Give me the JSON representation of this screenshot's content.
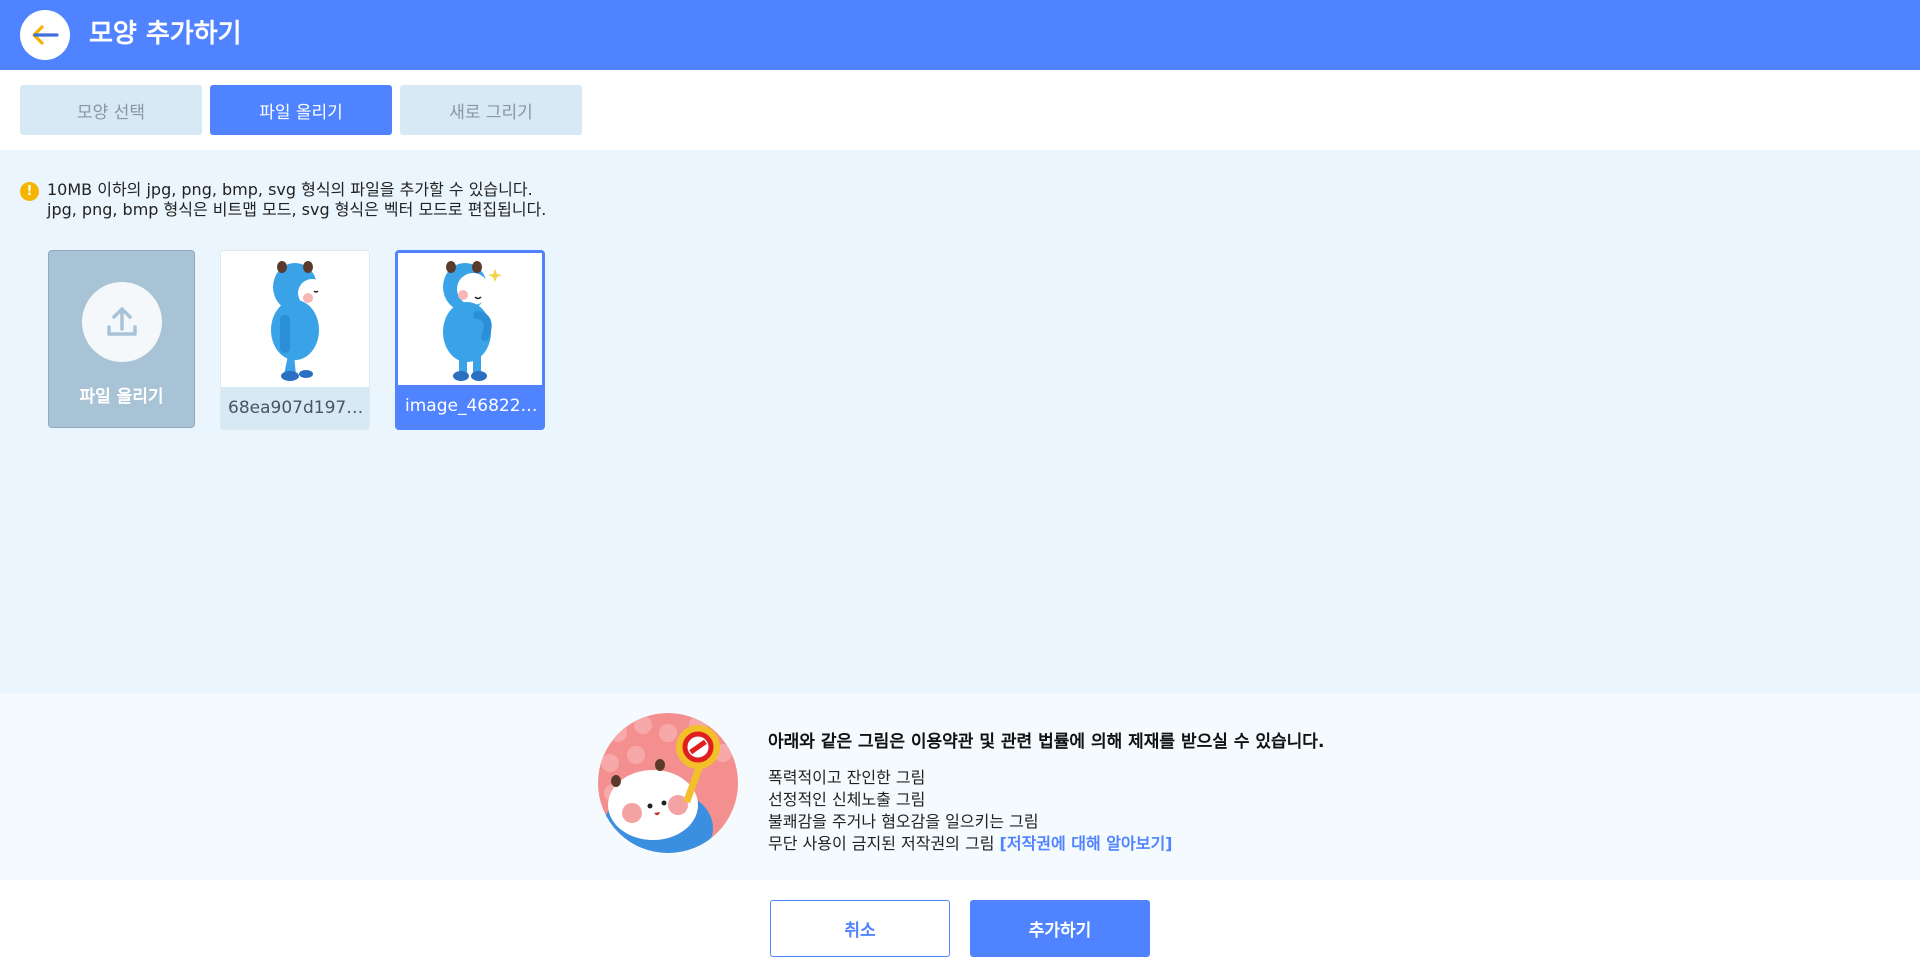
{
  "header": {
    "title": "모양 추가하기",
    "back_icon": "arrow-left-icon"
  },
  "tabs": [
    {
      "label": "모양 선택",
      "active": false
    },
    {
      "label": "파일 올리기",
      "active": true
    },
    {
      "label": "새로 그리기",
      "active": false
    }
  ],
  "notice": {
    "icon": "exclamation-icon",
    "line1": "10MB 이하의 jpg, png, bmp, svg 형식의 파일을 추가할 수 있습니다.",
    "line2": "jpg, png, bmp 형식은 비트맵 모드, svg 형식은 벡터 모드로 편집됩니다."
  },
  "upload": {
    "label": "파일 올리기",
    "icon": "upload-icon"
  },
  "files": [
    {
      "name": "68ea907d197…",
      "selected": false
    },
    {
      "name": "image_468221…",
      "selected": true
    }
  ],
  "warning": {
    "title": "아래와 같은 그림은 이용약관 및 관련 법률에 의해 제재를 받으실 수 있습니다.",
    "items": [
      "폭력적이고 잔인한 그림",
      "선정적인 신체노출 그림",
      "불쾌감을 주거나 혐오감을 일으키는 그림",
      "무단 사용이 금지된 저작권의 그림"
    ],
    "link": "[저작권에 대해 알아보기]"
  },
  "buttons": {
    "cancel": "취소",
    "confirm": "추가하기"
  },
  "colors": {
    "accent": "#4f83ff",
    "tab_inactive": "#d7e9f5",
    "upload_card": "#a9c3d6",
    "panel_bg": "#eaf5fd"
  }
}
